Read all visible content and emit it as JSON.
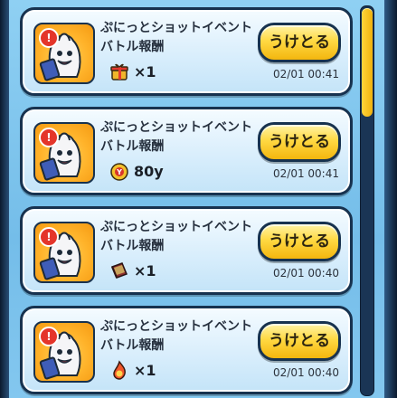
{
  "items": [
    {
      "title_line1": "ぷにっとショットイベント",
      "title_line2": "バトル報酬",
      "button_label": "うけとる",
      "reward_icon": "gift-box-icon",
      "quantity": "×1",
      "timestamp": "02/01 00:41"
    },
    {
      "title_line1": "ぷにっとショットイベント",
      "title_line2": "バトル報酬",
      "button_label": "うけとる",
      "reward_icon": "yen-coin-icon",
      "quantity": "80y",
      "timestamp": "02/01 00:41"
    },
    {
      "title_line1": "ぷにっとショットイベント",
      "title_line2": "バトル報酬",
      "button_label": "うけとる",
      "reward_icon": "book-icon",
      "quantity": "×1",
      "timestamp": "02/01 00:40"
    },
    {
      "title_line1": "ぷにっとショットイベント",
      "title_line2": "バトル報酬",
      "button_label": "うけとる",
      "reward_icon": "soul-flame-icon",
      "quantity": "×1",
      "timestamp": "02/01 00:40"
    }
  ],
  "badge_symbol": "!",
  "scrollbar": {
    "position": 0.0,
    "visible_fraction": 0.28
  },
  "colors": {
    "card_border": "#17324f",
    "button_fill": "#ffd943",
    "panel_bg": "#7fc4ee",
    "badge": "#e4352a"
  }
}
